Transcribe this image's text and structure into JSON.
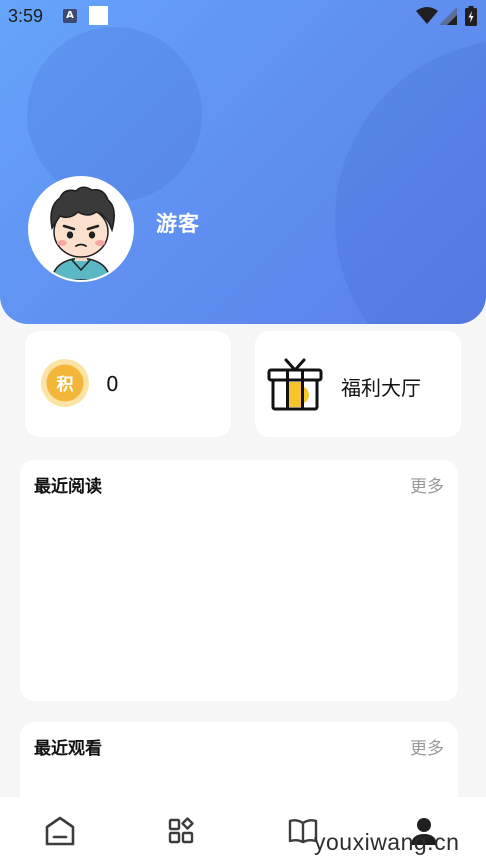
{
  "status_bar": {
    "time": "3:59",
    "icons": [
      "a-badge-icon",
      "white-square-icon",
      "wifi-icon",
      "cell-signal-icon",
      "battery-icon"
    ]
  },
  "profile": {
    "username": "游客",
    "avatar_icon": "cartoon-boy-avatar"
  },
  "points": {
    "badge_label": "积",
    "value": "0",
    "badge_color": "#f3b63a"
  },
  "welfare": {
    "label": "福利大厅",
    "icon": "gift-icon",
    "icon_color": "#f7c42e"
  },
  "sections": {
    "recent_reading": {
      "title": "最近阅读",
      "more": "更多"
    },
    "recent_watching": {
      "title": "最近观看",
      "more": "更多"
    }
  },
  "bottom_nav": {
    "items": [
      {
        "icon": "home-icon",
        "active": false
      },
      {
        "icon": "category-grid-icon",
        "active": false
      },
      {
        "icon": "book-icon",
        "active": false
      },
      {
        "icon": "profile-icon",
        "active": true
      }
    ]
  },
  "watermark": "youxiwang.cn",
  "colors": {
    "header_gradient_start": "#66a4fb",
    "header_gradient_end": "#5a80ea",
    "background": "#f6f6f6",
    "muted_text": "#9a9a9a"
  }
}
